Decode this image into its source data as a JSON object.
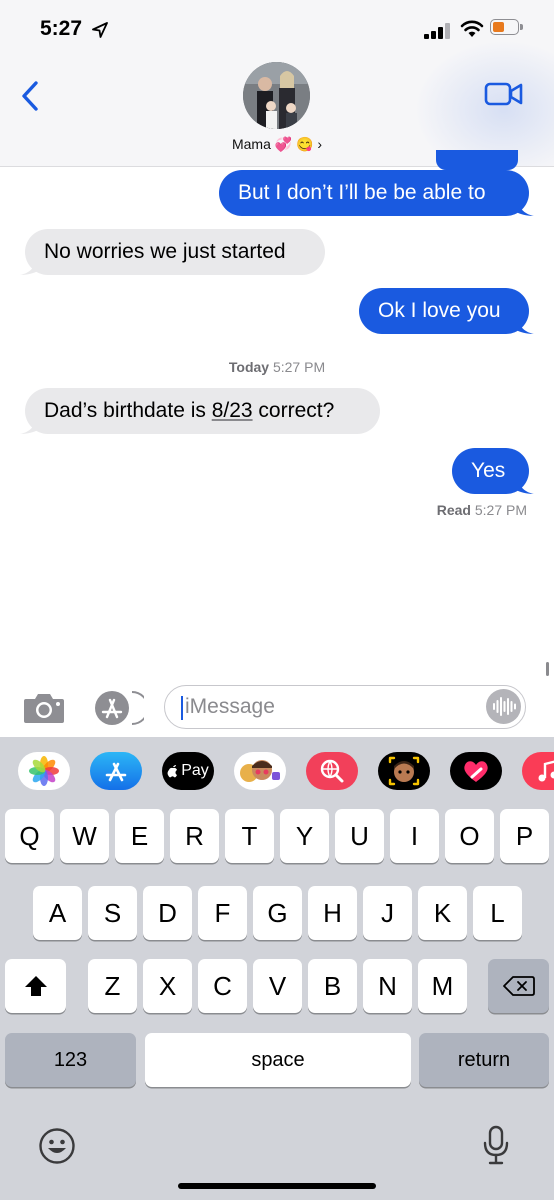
{
  "status_bar": {
    "time": "5:27",
    "battery_color": "#e87a1e"
  },
  "header": {
    "contact_name": "Mama 💞 😋 ›"
  },
  "messages": [
    {
      "direction": "outgoing",
      "text": "But I don’t I’ll be be able to"
    },
    {
      "direction": "incoming",
      "text": "No worries we just started"
    },
    {
      "direction": "outgoing",
      "text": "Ok I love you"
    },
    {
      "direction": "incoming",
      "text_before": "Dad’s birthdate is ",
      "date_text": "8/23",
      "text_after": " correct?"
    },
    {
      "direction": "outgoing",
      "text": "Yes"
    }
  ],
  "timestamp_day": {
    "label": "Today",
    "time": "5:27 PM"
  },
  "read_receipt": {
    "label": "Read",
    "time": "5:27 PM"
  },
  "input": {
    "placeholder": "iMessage"
  },
  "app_strip": [
    {
      "name": "photos-app",
      "icon": "photos-icon"
    },
    {
      "name": "app-store-app",
      "icon": "app-store-icon"
    },
    {
      "name": "apple-pay-app",
      "label": "Pay"
    },
    {
      "name": "memoji-stickers-app",
      "icon": "memoji-icon"
    },
    {
      "name": "images-search-app",
      "icon": "search-globe-icon"
    },
    {
      "name": "memoji-app",
      "icon": "memoji-icon"
    },
    {
      "name": "digital-touch-app",
      "icon": "heart-icon"
    },
    {
      "name": "music-app",
      "icon": "music-icon"
    }
  ],
  "keyboard": {
    "row1": [
      "Q",
      "W",
      "E",
      "R",
      "T",
      "Y",
      "U",
      "I",
      "O",
      "P"
    ],
    "row2": [
      "A",
      "S",
      "D",
      "F",
      "G",
      "H",
      "J",
      "K",
      "L"
    ],
    "row3": [
      "Z",
      "X",
      "C",
      "V",
      "B",
      "N",
      "M"
    ],
    "numbers_label": "123",
    "space_label": "space",
    "return_label": "return"
  },
  "colors": {
    "accent": "#1a5ae0",
    "incoming_bubble": "#e9e9eb",
    "keyboard_bg": "#d1d3d9"
  }
}
